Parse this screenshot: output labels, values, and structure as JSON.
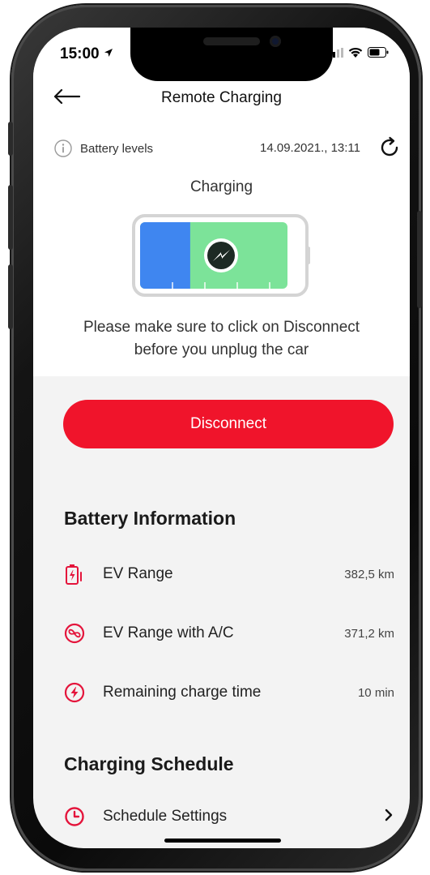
{
  "status_bar": {
    "time": "15:00"
  },
  "nav": {
    "title": "Remote Charging"
  },
  "battery_header": {
    "label": "Battery levels",
    "timestamp": "14.09.2021., 13:11"
  },
  "charging": {
    "status": "Charging",
    "level_fraction": 0.34,
    "message_line1": "Please make sure to click on Disconnect",
    "message_line2": "before you unplug the car"
  },
  "actions": {
    "disconnect_label": "Disconnect"
  },
  "battery_info": {
    "title": "Battery Information",
    "items": [
      {
        "icon": "battery-charge-icon",
        "label": "EV Range",
        "value": "382,5 km"
      },
      {
        "icon": "fan-icon",
        "label": "EV Range with A/C",
        "value": "371,2 km"
      },
      {
        "icon": "lightning-circle-icon",
        "label": "Remaining charge time",
        "value": "10 min"
      }
    ]
  },
  "charging_schedule": {
    "title": "Charging Schedule",
    "items": [
      {
        "icon": "clock-icon",
        "label": "Schedule Settings"
      }
    ]
  },
  "colors": {
    "accent_red": "#f0142b",
    "battery_blue": "#3f86f0",
    "battery_green": "#7ce399"
  }
}
